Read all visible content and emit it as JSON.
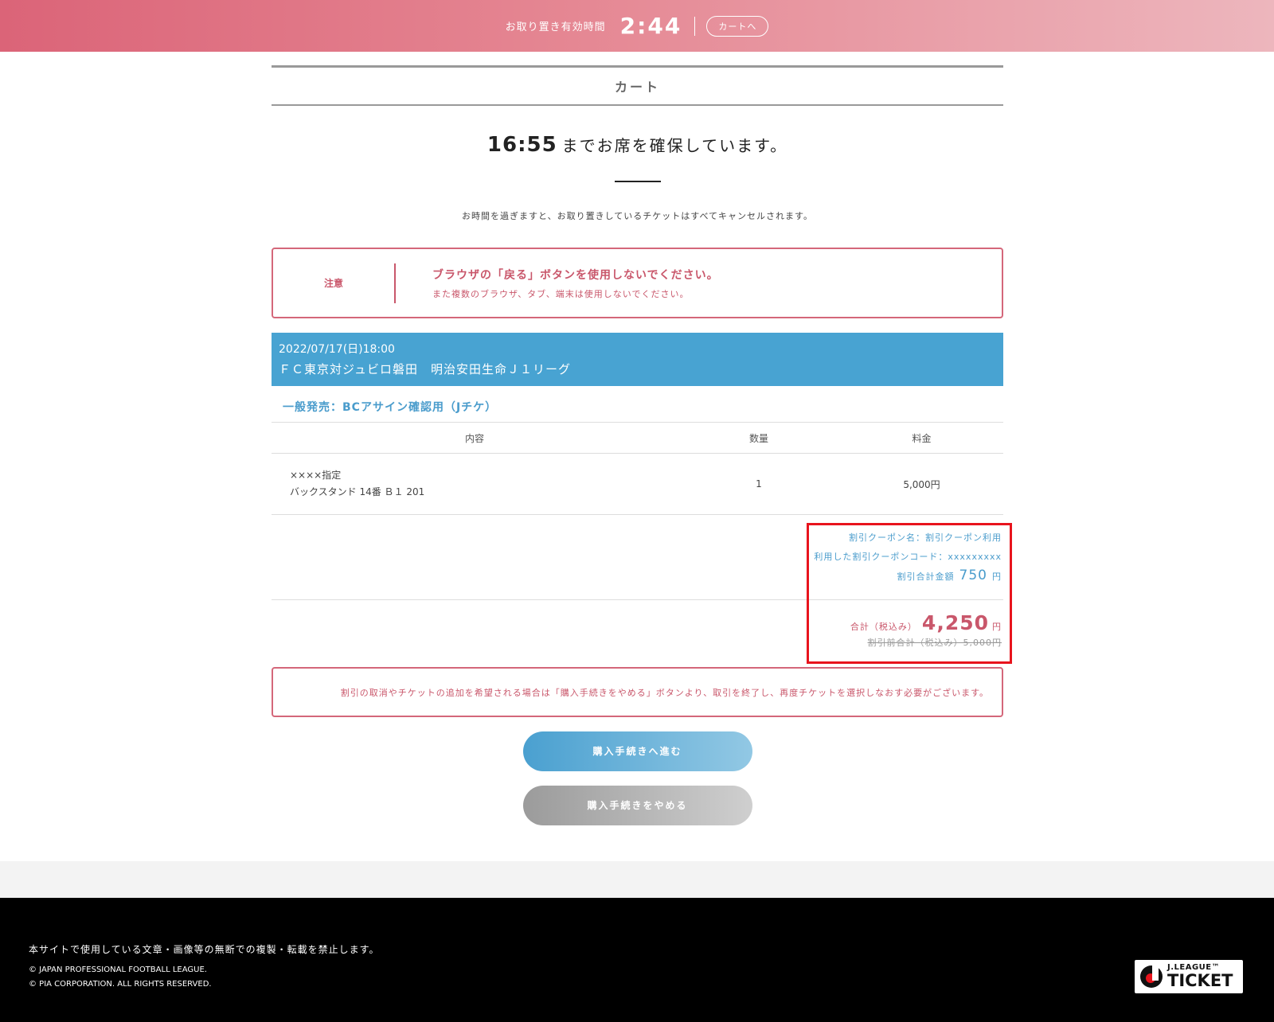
{
  "topbar": {
    "hold_label": "お取り置き有効時間",
    "hold_time": "2:44",
    "cart_button": "カートへ"
  },
  "cart": {
    "title": "カート",
    "reserve_time": "16:55",
    "reserve_text": "までお席を確保しています。",
    "expire_note": "お時間を過ぎますと、お取り置きしているチケットはすべてキャンセルされます。"
  },
  "caution": {
    "label": "注意",
    "main": "ブラウザの「戻る」ボタンを使用しないでください。",
    "sub": "また複数のブラウザ、タブ、端末は使用しないでください。"
  },
  "event": {
    "date": "2022/07/17(日)18:00",
    "name": "ＦＣ東京対ジュビロ磐田　明治安田生命Ｊ１リーグ"
  },
  "sale_type": "一般発売：BCアサイン確認用（Jチケ）",
  "table": {
    "headers": {
      "content": "内容",
      "qty": "数量",
      "price": "料金"
    },
    "rows": [
      {
        "line1": "××××指定",
        "line2": "バックスタンド 14番 Ｂ１ 201",
        "qty": "1",
        "price": "5,000円"
      }
    ]
  },
  "discount": {
    "coupon_name": "割引クーポン名：割引クーポン利用",
    "coupon_code": "利用した割引クーポンコード：xxxxxxxxx",
    "total_label": "割引合計金額",
    "total_amount": "750",
    "yen": "円"
  },
  "total": {
    "label": "合計（税込み）",
    "amount": "4,250",
    "yen": "円",
    "before": "割引前合計（税込み）5,000円"
  },
  "cancel_note": "割引の取消やチケットの追加を希望される場合は「購入手続きをやめる」ボタンより、取引を終了し、再度チケットを選択しなおす必要がございます。",
  "buttons": {
    "proceed": "購入手続きへ進む",
    "cancel": "購入手続きをやめる"
  },
  "footer": {
    "notice": "本サイトで使用している文章・画像等の無断での複製・転載を禁止します。",
    "copyright1": "© JAPAN PROFESSIONAL FOOTBALL LEAGUE.",
    "copyright2": "© PIA CORPORATION. ALL RIGHTS RESERVED.",
    "logo_line1": "J.LEAGUE™",
    "logo_line2": "TICKET"
  },
  "colors": {
    "accent_pink": "#d4677a",
    "accent_blue": "#48a3d2",
    "highlight_red": "#e8141d"
  }
}
